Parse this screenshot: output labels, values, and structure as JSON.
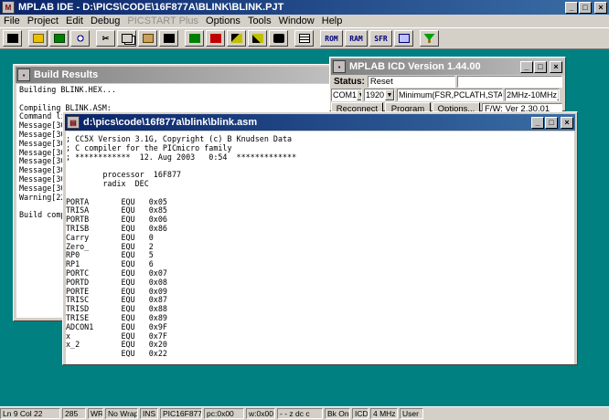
{
  "app": {
    "title": "MPLAB IDE - D:\\PICS\\CODE\\16F877A\\BLINK\\BLINK.PJT",
    "icon_text": "M"
  },
  "menu": [
    "File",
    "Project",
    "Edit",
    "Debug",
    "PICSTART Plus",
    "Options",
    "Tools",
    "Window",
    "Help"
  ],
  "menu_disabled_index": 4,
  "toolbar": {
    "text_buttons": [
      "ROM",
      "RAM",
      "SFR"
    ]
  },
  "build_results": {
    "title": "Build Results",
    "lines": [
      "Building BLINK.HEX...",
      "",
      "Compiling BLINK.ASM:",
      "Command li",
      "Message[30",
      "Message[30",
      "Message[30",
      "Message[30",
      "Message[30",
      "Message[30",
      "Message[30",
      "Message[30",
      "Warning[22",
      "",
      "Build comp"
    ]
  },
  "icd": {
    "title": "MPLAB ICD Version 1.44.00",
    "status_label": "Status:",
    "status_value": "Reset",
    "port": "COM1",
    "baud": "1920",
    "mode": "Minimum(FSR,PCLATH,STA",
    "freq": "2MHz-10MHz",
    "reconnect_label": "Reconnect",
    "program_label": "Program",
    "options_label": "Options...",
    "firmware": "F/W: Ver 2.30.01"
  },
  "asm": {
    "title": "d:\\pics\\code\\16f877a\\blink\\blink.asm",
    "lines": [
      "; CC5X Version 3.1G, Copyright (c) B Knudsen Data",
      "; C compiler for the PICmicro family",
      "; ************  12. Aug 2003   0:54  *************",
      "",
      "        processor  16F877",
      "        radix  DEC",
      "",
      "PORTA       EQU   0x05",
      "TRISA       EQU   0x85",
      "PORTB       EQU   0x06",
      "TRISB       EQU   0x86",
      "Carry       EQU   0",
      "Zero_       EQU   2",
      "RP0         EQU   5",
      "RP1         EQU   6",
      "PORTC       EQU   0x07",
      "PORTD       EQU   0x08",
      "PORTE       EQU   0x09",
      "TRISC       EQU   0x87",
      "TRISD       EQU   0x88",
      "TRISE       EQU   0x89",
      "ADCON1      EQU   0x9F",
      "x           EQU   0x7F",
      "x_2         EQU   0x20",
      "            EQU   0x22"
    ]
  },
  "statusbar": {
    "items": [
      "Ln 9 Col 22",
      "285",
      "WR",
      "No Wrap",
      "INS",
      "PIC16F877",
      "pc:0x00",
      "w:0x00",
      "- - z dc c",
      "Bk On",
      "ICD",
      "4 MHz",
      "User"
    ]
  },
  "colors": {
    "desktop": "#008080",
    "active_title": "#0a246a",
    "inactive_title": "#808080",
    "face": "#d4d0c8"
  }
}
